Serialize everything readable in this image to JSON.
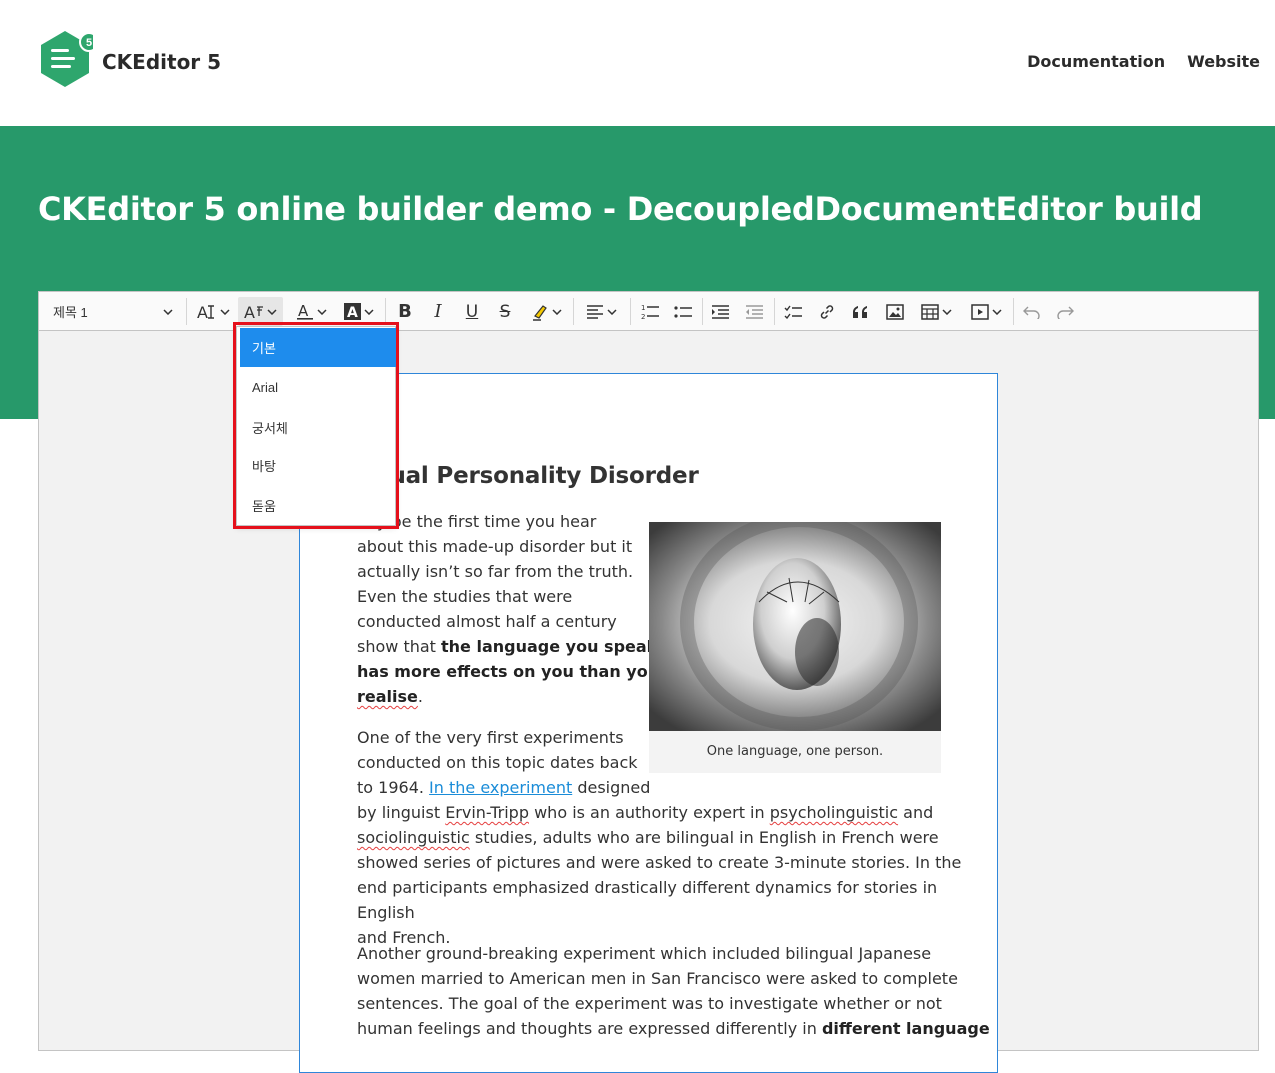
{
  "header": {
    "logo_badge": "5",
    "logo_text": "CKEditor 5",
    "nav": [
      {
        "label": "Documentation"
      },
      {
        "label": "Website"
      }
    ]
  },
  "hero": {
    "title": "CKEditor 5 online builder demo - DecoupledDocumentEditor build"
  },
  "toolbar": {
    "heading_value": "제목 1"
  },
  "font_family_dropdown": {
    "options": [
      {
        "label": "기본",
        "selected": true
      },
      {
        "label": "Arial",
        "selected": false
      },
      {
        "label": "궁서체",
        "selected": false
      },
      {
        "label": "바탕",
        "selected": false
      },
      {
        "label": "돋움",
        "selected": false
      }
    ]
  },
  "document": {
    "title_fragment": "ngual Personality Disorder",
    "p1": {
      "l1": "nay be the first time you hear",
      "l2": "about this made-up disorder but it",
      "l3": "actually isn’t so far from the truth.",
      "l4": "Even the studies that were",
      "l5": "conducted almost half a century",
      "l6_a": "show that ",
      "l6_b": "the language you speak",
      "l7": "has more effects on you than you",
      "l8": "realise",
      "l8_end": "."
    },
    "p2": {
      "l1": "One of the very first experiments",
      "l2": "conducted on this topic dates back",
      "l3_a": "to 1964. ",
      "l3_link": "In the experiment",
      "l3_b": " designed",
      "l4_a": "by linguist ",
      "l4_s1": "Ervin-Tripp",
      "l4_b": " who is an authority expert in ",
      "l4_s2": "psycholinguistic",
      "l4_c": " and",
      "l5_s": "sociolinguistic",
      "l5_b": " studies, adults who are bilingual in English in French were",
      "l6": "showed series of pictures and were asked to create 3-minute stories. In the",
      "l7": "end participants emphasized drastically different dynamics for stories in English",
      "l8": "and French."
    },
    "p3": {
      "l1": "Another ground-breaking experiment which included bilingual Japanese",
      "l2": "women married to American men in San Francisco were asked to complete",
      "l3": "sentences. The goal of the experiment was to investigate whether or not",
      "l4_a": "human feelings and thoughts are expressed differently in ",
      "l4_b": "different language"
    },
    "figure_caption": "One language, one person."
  },
  "colors": {
    "brand_green": "#27996a",
    "selected_blue": "#1e8ced",
    "highlight_red": "#e5101b"
  }
}
